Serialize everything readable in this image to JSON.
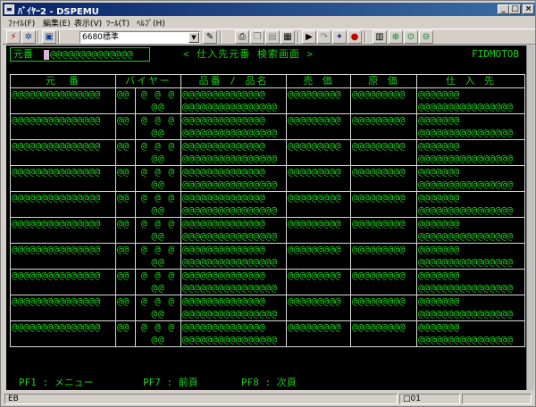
{
  "window": {
    "title": "ﾊﾞｲﾔｰ2 - DSPEMU",
    "controls": [
      "_",
      "□",
      "×"
    ]
  },
  "menu": {
    "items": [
      "ﾌｧｲﾙ(F)",
      "編集(E)",
      "表示(V)",
      "ﾂｰﾙ(T)",
      "ﾍﾙﾌﾟ(H)"
    ]
  },
  "toolbar": {
    "combo_value": "6680標準",
    "icons": [
      "lightning-icon",
      "grid-icon",
      "screen-icon",
      "wrench-icon",
      "print-icon",
      "copy-icon",
      "paste-icon",
      "keypad-icon",
      "play-icon",
      "step-icon",
      "macro-icon",
      "record-icon",
      "calc-icon",
      "zoom-in-icon",
      "zoom-fit-icon",
      "zoom-out-icon"
    ]
  },
  "screen": {
    "key_label": "元番",
    "key_value": "@@@@@@@@@@@@@@",
    "title": "<  仕入先元番  検索画面  >",
    "program_id": "FIDMOTOB",
    "columns": [
      "元　番",
      "バイヤー",
      "品番 / 品名",
      "売 価",
      "原 価",
      "仕 入 先"
    ],
    "rows": [
      {
        "motoban": "@@@@@@@@@@@@@@@",
        "b1": "@@",
        "b2a": "@ @ @",
        "b2b": "@@",
        "hin1": "@@@@@@@@@@@@@@",
        "hin2": "@@@@@@@@@@@@@@@@",
        "baika": "@@@@@@@@@",
        "genka": "@@@@@@@@@",
        "shi1": "@@@@@@@",
        "shi2": "@@@@@@@@@@@@@@@@"
      },
      {
        "motoban": "@@@@@@@@@@@@@@@",
        "b1": "@@",
        "b2a": "@ @ @",
        "b2b": "@@",
        "hin1": "@@@@@@@@@@@@@@",
        "hin2": "@@@@@@@@@@@@@@@@",
        "baika": "@@@@@@@@@",
        "genka": "@@@@@@@@@",
        "shi1": "@@@@@@@",
        "shi2": "@@@@@@@@@@@@@@@@"
      },
      {
        "motoban": "@@@@@@@@@@@@@@@",
        "b1": "@@",
        "b2a": "@ @ @",
        "b2b": "@@",
        "hin1": "@@@@@@@@@@@@@@",
        "hin2": "@@@@@@@@@@@@@@@@",
        "baika": "@@@@@@@@@",
        "genka": "@@@@@@@@@",
        "shi1": "@@@@@@@",
        "shi2": "@@@@@@@@@@@@@@@@"
      },
      {
        "motoban": "@@@@@@@@@@@@@@@",
        "b1": "@@",
        "b2a": "@ @ @",
        "b2b": "@@",
        "hin1": "@@@@@@@@@@@@@@",
        "hin2": "@@@@@@@@@@@@@@@@",
        "baika": "@@@@@@@@@",
        "genka": "@@@@@@@@@",
        "shi1": "@@@@@@@",
        "shi2": "@@@@@@@@@@@@@@@@"
      },
      {
        "motoban": "@@@@@@@@@@@@@@@",
        "b1": "@@",
        "b2a": "@ @ @",
        "b2b": "@@",
        "hin1": "@@@@@@@@@@@@@@",
        "hin2": "@@@@@@@@@@@@@@@@",
        "baika": "@@@@@@@@@",
        "genka": "@@@@@@@@@",
        "shi1": "@@@@@@@",
        "shi2": "@@@@@@@@@@@@@@@@"
      },
      {
        "motoban": "@@@@@@@@@@@@@@@",
        "b1": "@@",
        "b2a": "@ @ @",
        "b2b": "@@",
        "hin1": "@@@@@@@@@@@@@@",
        "hin2": "@@@@@@@@@@@@@@@@",
        "baika": "@@@@@@@@@",
        "genka": "@@@@@@@@@",
        "shi1": "@@@@@@@",
        "shi2": "@@@@@@@@@@@@@@@@"
      },
      {
        "motoban": "@@@@@@@@@@@@@@@",
        "b1": "@@",
        "b2a": "@ @ @",
        "b2b": "@@",
        "hin1": "@@@@@@@@@@@@@@",
        "hin2": "@@@@@@@@@@@@@@@@",
        "baika": "@@@@@@@@@",
        "genka": "@@@@@@@@@",
        "shi1": "@@@@@@@",
        "shi2": "@@@@@@@@@@@@@@@@"
      },
      {
        "motoban": "@@@@@@@@@@@@@@@",
        "b1": "@@",
        "b2a": "@ @ @",
        "b2b": "@@",
        "hin1": "@@@@@@@@@@@@@@",
        "hin2": "@@@@@@@@@@@@@@@@",
        "baika": "@@@@@@@@@",
        "genka": "@@@@@@@@@",
        "shi1": "@@@@@@@",
        "shi2": "@@@@@@@@@@@@@@@@"
      },
      {
        "motoban": "@@@@@@@@@@@@@@@",
        "b1": "@@",
        "b2a": "@ @ @",
        "b2b": "@@",
        "hin1": "@@@@@@@@@@@@@@",
        "hin2": "@@@@@@@@@@@@@@@@",
        "baika": "@@@@@@@@@",
        "genka": "@@@@@@@@@",
        "shi1": "@@@@@@@",
        "shi2": "@@@@@@@@@@@@@@@@"
      },
      {
        "motoban": "@@@@@@@@@@@@@@@",
        "b1": "@@",
        "b2a": "@ @ @",
        "b2b": "@@",
        "hin1": "@@@@@@@@@@@@@@",
        "hin2": "@@@@@@@@@@@@@@@@",
        "baika": "@@@@@@@@@",
        "genka": "@@@@@@@@@",
        "shi1": "@@@@@@@",
        "shi2": "@@@@@@@@@@@@@@@@"
      }
    ],
    "function_keys": [
      "PF1 : メニュー",
      "PF7 : 前頁",
      "PF8 : 次頁"
    ]
  },
  "status": {
    "left": "EB",
    "right": "□01"
  },
  "colors": {
    "terminal_bg": "#000000",
    "terminal_fg": "#19d019",
    "grid_line": "#d8d8d8",
    "titlebar": "#0a246a"
  }
}
